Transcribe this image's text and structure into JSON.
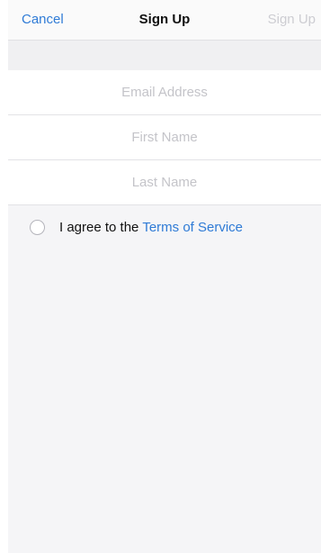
{
  "navbar": {
    "cancel_label": "Cancel",
    "title": "Sign Up",
    "signup_label": "Sign Up"
  },
  "form": {
    "email_placeholder": "Email Address",
    "first_name_placeholder": "First Name",
    "last_name_placeholder": "Last Name",
    "email_value": "",
    "first_name_value": "",
    "last_name_value": ""
  },
  "agreement": {
    "text": "I agree to the",
    "link_text": "Terms of Service",
    "checked": false
  },
  "colors": {
    "accent": "#2f7bd6",
    "disabled_text": "#cdcdd2",
    "placeholder": "#c4c4c9",
    "background": "#f5f5f7"
  }
}
